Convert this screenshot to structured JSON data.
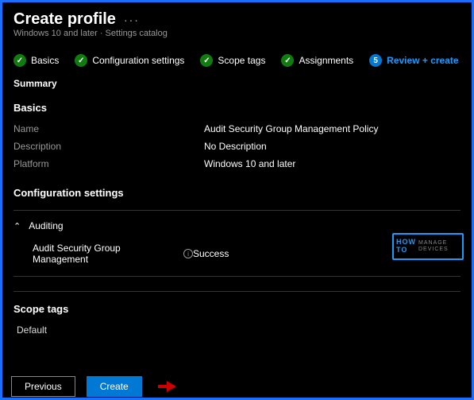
{
  "header": {
    "title": "Create profile",
    "subtitle": "Windows 10 and later · Settings catalog"
  },
  "steps": {
    "s1": "Basics",
    "s2": "Configuration settings",
    "s3": "Scope tags",
    "s4": "Assignments",
    "s5": "Review + create"
  },
  "summary": {
    "heading": "Summary",
    "basics_heading": "Basics",
    "name_k": "Name",
    "name_v": "Audit Security Group Management Policy",
    "desc_k": "Description",
    "desc_v": "No Description",
    "plat_k": "Platform",
    "plat_v": "Windows 10 and later"
  },
  "config": {
    "heading": "Configuration settings",
    "auditing": "Auditing",
    "setting_label": "Audit Security Group Management",
    "setting_value": "Success"
  },
  "scope": {
    "heading": "Scope tags",
    "value": "Default"
  },
  "buttons": {
    "prev": "Previous",
    "create": "Create"
  },
  "icons": {
    "step_num": "5"
  },
  "watermark": {
    "how": "HOW\nTO",
    "txt": "MANAGE\nDEVICES"
  }
}
